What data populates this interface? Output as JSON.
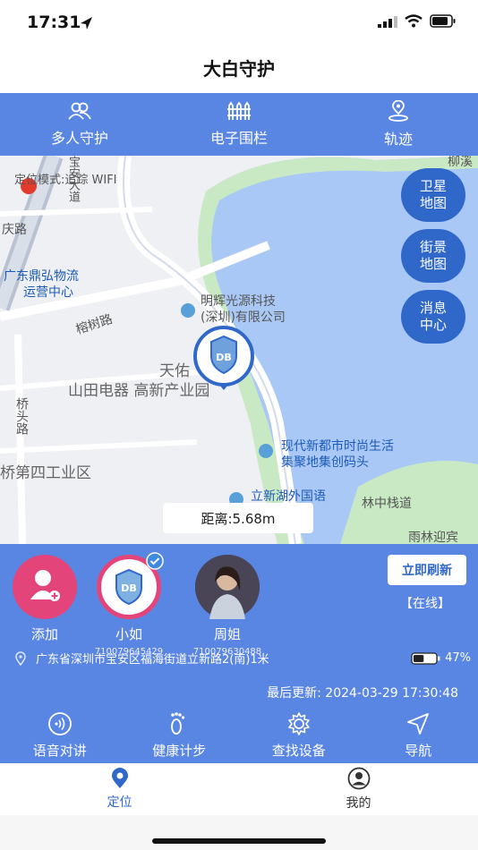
{
  "status": {
    "time": "17:31"
  },
  "app": {
    "title": "大白守护"
  },
  "top_tabs": [
    {
      "label": "多人守护",
      "icon": "multi-user-icon"
    },
    {
      "label": "电子围栏",
      "icon": "fence-icon"
    },
    {
      "label": "轨迹",
      "icon": "location-track-icon"
    }
  ],
  "map": {
    "labels": {
      "mode": "定位模式:追踪 WIFI",
      "road_qing": "庆路",
      "logistics1": "广东鼎弘物流",
      "logistics2": "运营中心",
      "bangshu": "榕树路",
      "company1": "明辉光源科技",
      "company2": "(深圳)有限公司",
      "tianyou": "天佑",
      "shantian": "山田电器 高新产业园",
      "qiao_road": "桥头路",
      "industrial": "桥第四工业区",
      "modern1": "现代新都市时尚生活",
      "modern2": "集聚地集创码头",
      "lake_garden": "立新湖外国语",
      "plank": "林中栈道",
      "yulin": "雨林迎宾",
      "liu": "柳溪",
      "road_top": "宝安大道"
    },
    "buttons": [
      {
        "label": "卫星地图"
      },
      {
        "label": "街景地图"
      },
      {
        "label": "消息中心"
      }
    ],
    "distance": "距离:5.68m"
  },
  "devices": [
    {
      "name": "添加",
      "id": ""
    },
    {
      "name": "小如",
      "id": "710079645429"
    },
    {
      "name": "周姐",
      "id": "710079630488"
    }
  ],
  "refresh_label": "立即刷新",
  "online_status": "【在线】",
  "address": "广东省深圳市宝安区福海街道立新路2(南)1米",
  "battery": {
    "percent_text": "47%",
    "level": 0.47
  },
  "last_update": "最后更新: 2024-03-29 17:30:48",
  "actions": [
    {
      "label": "语音对讲",
      "icon": "voice-icon"
    },
    {
      "label": "健康计步",
      "icon": "footprint-icon"
    },
    {
      "label": "查找设备",
      "icon": "gear-icon"
    },
    {
      "label": "导航",
      "icon": "navigation-icon"
    }
  ],
  "bottom_nav": [
    {
      "label": "定位",
      "icon": "location-pin-icon",
      "active": true
    },
    {
      "label": "我的",
      "icon": "profile-icon",
      "active": false
    }
  ],
  "colors": {
    "primary": "#5a86e3",
    "accent": "#2f68c9",
    "pink": "#e3457a",
    "lake": "#a9c8f5",
    "park": "#c9e9c4"
  }
}
